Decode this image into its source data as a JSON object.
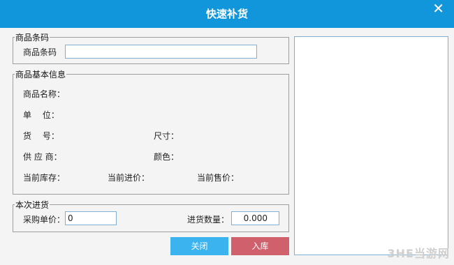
{
  "dialog": {
    "title": "快速补货",
    "close_glyph": "✕"
  },
  "barcode_group": {
    "legend": "商品条码",
    "label": "商品条码",
    "value": ""
  },
  "info_group": {
    "legend": "商品基本信息",
    "name_label": "商品名称：",
    "unit_label": "单　 位：",
    "item_no_label": "货　 号：",
    "size_label": "尺寸：",
    "supplier_label": "供 应 商：",
    "color_label": "颜色：",
    "stock_label": "当前库存：",
    "cost_label": "当前进价：",
    "price_label": "当前售价："
  },
  "purchase_group": {
    "legend": "本次进货",
    "unit_price_label": "采购单价：",
    "unit_price_value": "0",
    "qty_label": "进货数量：",
    "qty_value": "0.000"
  },
  "buttons": {
    "close": "关闭",
    "store": "入库"
  },
  "watermark": "3HE当游网",
  "colors": {
    "titlebar": "#1296db",
    "close_button": "#3bb3ee",
    "store_button": "#cf606c"
  }
}
